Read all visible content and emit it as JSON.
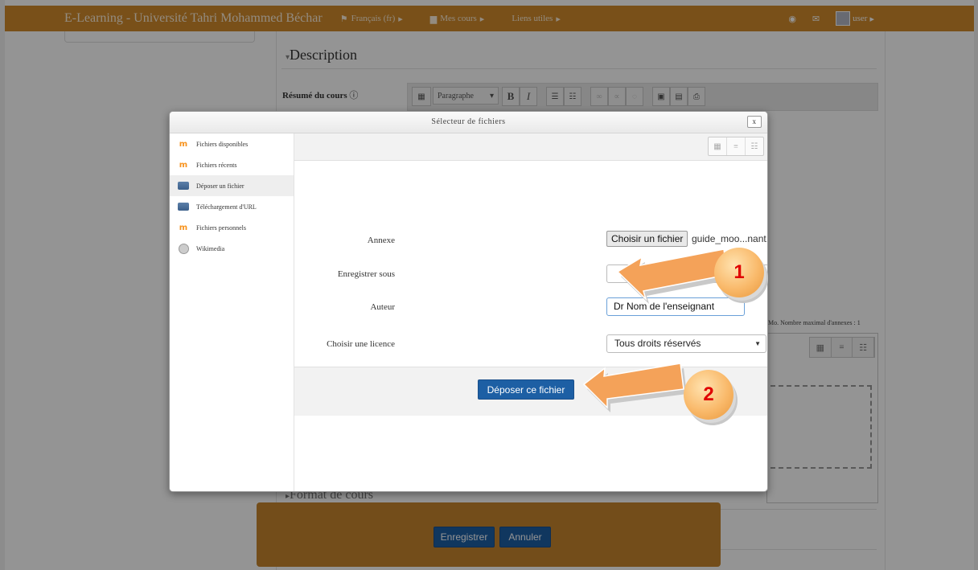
{
  "navbar": {
    "site_title": "E-Learning - Université Tahri Mohammed Béchar",
    "language_menu": "Français (fr)",
    "courses_menu": "Mes cours",
    "links_menu": "Liens utiles",
    "user_menu": "user"
  },
  "background_page": {
    "description_header": "Description",
    "summary_label": "Résumé du cours",
    "format_select": "Paragraphe",
    "attachments_note": "Mo. Nombre maximal d'annexes : 1",
    "course_format_header": "Format de cours",
    "save_button": "Enregistrer",
    "cancel_button": "Annuler"
  },
  "file_picker": {
    "title": "Sélecteur de fichiers",
    "close_label": "x",
    "repositories": [
      {
        "label": "Fichiers disponibles",
        "icon": "moodle-icon"
      },
      {
        "label": "Fichiers récents",
        "icon": "moodle-icon"
      },
      {
        "label": "Déposer un fichier",
        "icon": "upload-icon",
        "active": true
      },
      {
        "label": "Téléchargement d'URL",
        "icon": "upload-icon"
      },
      {
        "label": "Fichiers personnels",
        "icon": "moodle-icon"
      },
      {
        "label": "Wikimedia",
        "icon": "wikimedia-icon"
      }
    ],
    "form": {
      "attachment_label": "Annexe",
      "choose_file_button": "Choisir un fichier",
      "chosen_file_name": "guide_moo...nant.pdf",
      "save_as_label": "Enregistrer sous",
      "save_as_value": "",
      "author_label": "Auteur",
      "author_value": "Dr Nom de l'enseignant",
      "license_label": "Choisir une licence",
      "license_value": "Tous droits réservés",
      "upload_button": "Déposer ce fichier"
    }
  },
  "annotations": {
    "callout_1": "1",
    "callout_2": "2",
    "arrow_color": "#f4a259",
    "circle_color": "#f9b96a",
    "number_color": "#e00000"
  },
  "colors": {
    "navbar": "#d08a2c",
    "footer": "#c7852d",
    "primary_button": "#1d5fa4"
  }
}
